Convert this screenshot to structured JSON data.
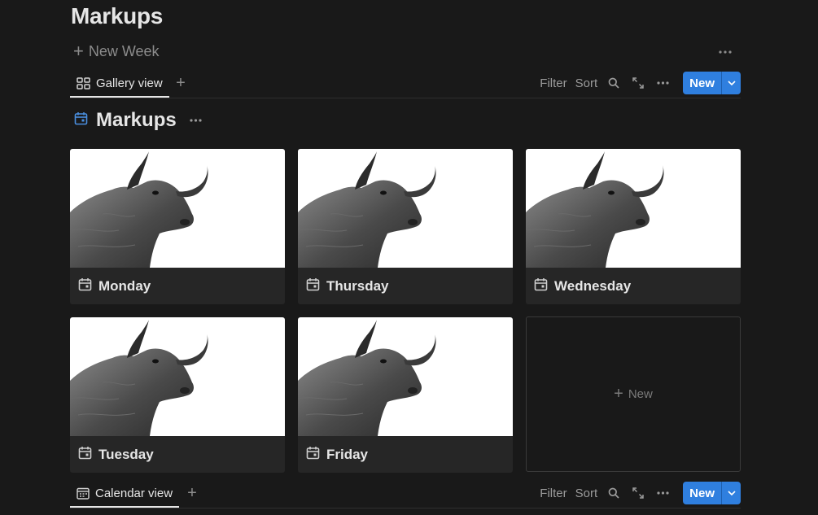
{
  "page": {
    "title": "Markups"
  },
  "actions": {
    "new_week": "New Week"
  },
  "views": [
    {
      "label": "Gallery view",
      "icon": "gallery-icon"
    },
    {
      "label": "Calendar view",
      "icon": "calendar-view-icon"
    }
  ],
  "toolbar": {
    "filter": "Filter",
    "sort": "Sort",
    "new_label": "New"
  },
  "database": {
    "title": "Markups",
    "icon": "calendar-icon"
  },
  "cards": [
    {
      "label": "Monday"
    },
    {
      "label": "Thursday"
    },
    {
      "label": "Wednesday"
    },
    {
      "label": "Tuesday"
    },
    {
      "label": "Friday"
    }
  ],
  "new_card": {
    "label": "New"
  },
  "colors": {
    "accent": "#2f7fdf",
    "background": "#191919",
    "card": "#262626"
  }
}
